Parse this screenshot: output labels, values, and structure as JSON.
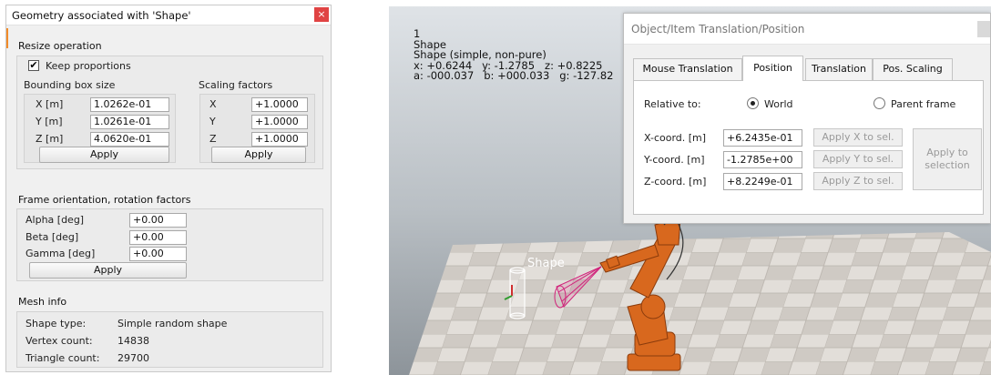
{
  "geometry_dialog": {
    "title": "Geometry associated with 'Shape'",
    "close_icon": "close-icon",
    "resize": {
      "section_label": "Resize operation",
      "keep_proportions": {
        "label": "Keep proportions",
        "checked": true
      },
      "bbox_label": "Bounding box size",
      "bbox_rows": [
        {
          "label": "X [m]",
          "value": "1.0262e-01"
        },
        {
          "label": "Y [m]",
          "value": "1.0261e-01"
        },
        {
          "label": "Z [m]",
          "value": "4.0620e-01"
        }
      ],
      "bbox_apply": "Apply",
      "scaling_label": "Scaling factors",
      "scaling_rows": [
        {
          "label": "X",
          "value": "+1.0000"
        },
        {
          "label": "Y",
          "value": "+1.0000"
        },
        {
          "label": "Z",
          "value": "+1.0000"
        }
      ],
      "scaling_apply": "Apply"
    },
    "frame": {
      "section_label": "Frame orientation, rotation factors",
      "rows": [
        {
          "label": "Alpha [deg]",
          "value": "+0.00"
        },
        {
          "label": "Beta [deg]",
          "value": "+0.00"
        },
        {
          "label": "Gamma [deg]",
          "value": "+0.00"
        }
      ],
      "apply": "Apply"
    },
    "mesh": {
      "section_label": "Mesh info",
      "rows": [
        {
          "label": "Shape type:",
          "value": "Simple random shape"
        },
        {
          "label": "Vertex count:",
          "value": "14838"
        },
        {
          "label": "Triangle count:",
          "value": "29700"
        }
      ]
    }
  },
  "viewport": {
    "info_lines": [
      "1",
      "Shape",
      "Shape (simple, non-pure)",
      "x: +0.6244   y: -1.2785   z: +0.8225",
      "a: -000.037   b: +000.033   g: -127.82"
    ],
    "shape_label": "Shape"
  },
  "translation_dialog": {
    "title": "Object/Item Translation/Position",
    "tabs": [
      "Mouse Translation",
      "Position",
      "Translation",
      "Pos. Scaling"
    ],
    "active_tab": "Position",
    "relative_to_label": "Relative to:",
    "relative_options": [
      {
        "label": "World",
        "selected": true
      },
      {
        "label": "Parent frame",
        "selected": false
      }
    ],
    "coords": [
      {
        "label": "X-coord. [m]",
        "value": "+6.2435e-01",
        "button": "Apply X to sel."
      },
      {
        "label": "Y-coord. [m]",
        "value": "-1.2785e+00",
        "button": "Apply Y to sel."
      },
      {
        "label": "Z-coord. [m]",
        "value": "+8.2249e-01",
        "button": "Apply Z to sel."
      }
    ],
    "apply_to_selection": [
      "Apply to",
      "selection"
    ]
  },
  "colors": {
    "close_button": "#e04343",
    "robot_orange": "#d8681e",
    "floor_tile_light": "#e2ded9",
    "floor_tile_dark": "#cfcac4",
    "cone_magenta": "#d0227a"
  }
}
